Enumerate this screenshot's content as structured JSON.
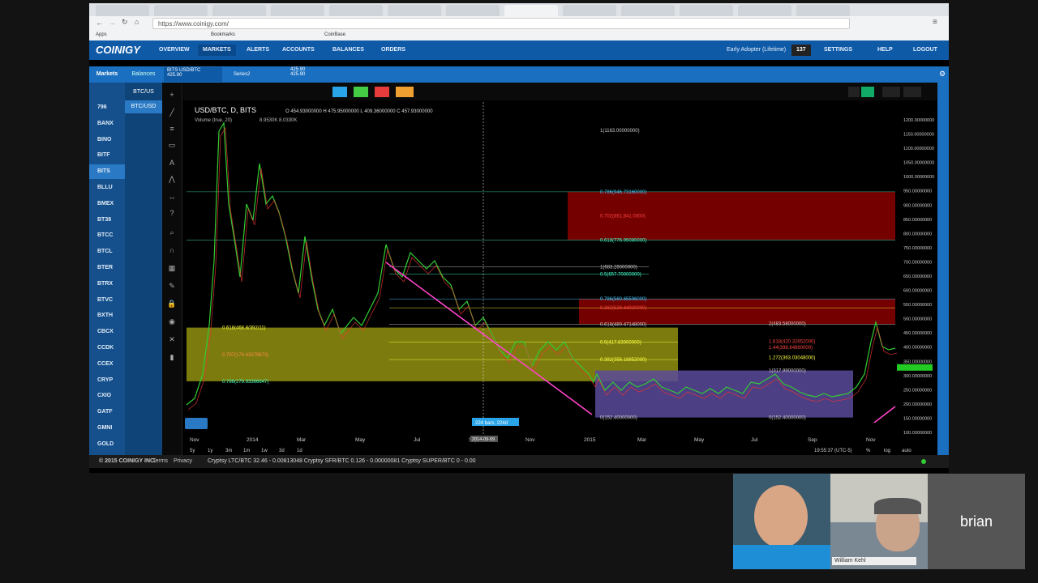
{
  "browser": {
    "tabs": [
      "",
      "",
      "",
      "",
      "",
      "",
      "",
      "",
      "",
      "",
      "",
      "",
      ""
    ],
    "url": "https://www.coinigy.com/",
    "bookmarks": [
      "Apps",
      "Bookmarks",
      "CoinBase"
    ]
  },
  "nav": {
    "logo": "COINIGY",
    "items": [
      "OVERVIEW",
      "MARKETS",
      "ALERTS",
      "ACCOUNTS",
      "BALANCES",
      "ORDERS"
    ],
    "user": "Early Adopter (Lifetime)",
    "count": "137",
    "settings": "SETTINGS",
    "help": "HELP",
    "logout": "LOGOUT"
  },
  "subnav": {
    "tabs": [
      "Markets",
      "Balances"
    ],
    "pair1": "BITS USD/BTC",
    "pair1_price": "425.90",
    "pair2": "Series2",
    "pair3_a": "425.90",
    "pair3_b": "425.90"
  },
  "sidebar": {
    "exchanges": [
      "796",
      "BANX",
      "BINO",
      "BITF",
      "BITS",
      "BLLU",
      "BMEX",
      "BT38",
      "BTCC",
      "BTCL",
      "BTER",
      "BTRX",
      "BTVC",
      "BXTH",
      "CBCX",
      "CCDK",
      "CCEX",
      "CRYP",
      "CXIO",
      "GATF",
      "GMNI",
      "GOLD"
    ],
    "active": "BITS",
    "markets": [
      "BTC/US",
      "BTC/USD"
    ]
  },
  "chart": {
    "symbol": "USD/BTC, D, BITS",
    "ohlc": "O 454.93000000  H 475.95000000  L 409.36000000  C 457.93000000",
    "volume": "Volume (true, 20)",
    "volume_val": "8.9530K 8.0330K",
    "x_labels": [
      "Nov",
      "2014",
      "Mar",
      "May",
      "Jul",
      "Sep",
      "Nov",
      "2015",
      "Mar",
      "May",
      "Jul",
      "Sep",
      "Nov"
    ],
    "y_labels": [
      "1200.00000000",
      "1150.00000000",
      "1100.00000000",
      "1050.00000000",
      "1000.00000000",
      "950.00000000",
      "900.00000000",
      "850.00000000",
      "800.00000000",
      "750.00000000",
      "700.00000000",
      "650.00000000",
      "600.00000000",
      "550.00000000",
      "500.00000000",
      "450.00000000",
      "400.00000000",
      "350.00000000",
      "300.00000000",
      "250.00000000",
      "200.00000000",
      "150.00000000",
      "100.00000000"
    ],
    "fib_labels": [
      "1(1163.00000000)",
      "0.786(946.73160000)",
      "0.702(861.841.0000)",
      "0.618(776.95080000)",
      "1(683.26000000)",
      "0.5(657.70000000)",
      "0.786(569.65596000)",
      "0.382(538.44920000)",
      "0.618(480.47148000)",
      "0.5(417.83000000)",
      "0.382(356.18852000)",
      "1(317.99000000)",
      "0(152.40000000)",
      "0.618(468.8/392/11)",
      "0.707(174.43379673)",
      "0.786(279.93366647)",
      "2(483.58000000)",
      "1.618(420.32652000)",
      "1.44(398.84860000)",
      "1.272(363.03048000)",
      "0(152.40000000)"
    ],
    "time_buttons": [
      "5y",
      "1y",
      "3m",
      "1m",
      "1w",
      "3d",
      "1d"
    ],
    "bars_label": "224 bars, 224d",
    "clock": "19:55:37 (UTC-5)",
    "scale_opts": [
      "%",
      "log",
      "auto"
    ],
    "date_cursor": "2014-09-09"
  },
  "footer": {
    "copyright": "© 2015 COINIGY INC.",
    "terms": "Terms",
    "privacy": "Privacy",
    "ticker": "Cryptsy LTC/BTC 32.46 - 0.00813048    Cryptsy SFR/BTC 0.126 - 0.00000081    Cryptsy SUPER/BTC 0 - 0.00"
  },
  "video": {
    "cam2_label": "William Kehl",
    "cam3_name": "brian"
  },
  "colors": {
    "nav": "#0f5aa7",
    "fib_red": "#8b0000",
    "fib_yellow": "#a0a000",
    "fib_purple": "#6a4fa0",
    "trend_magenta": "#ff44cc"
  }
}
